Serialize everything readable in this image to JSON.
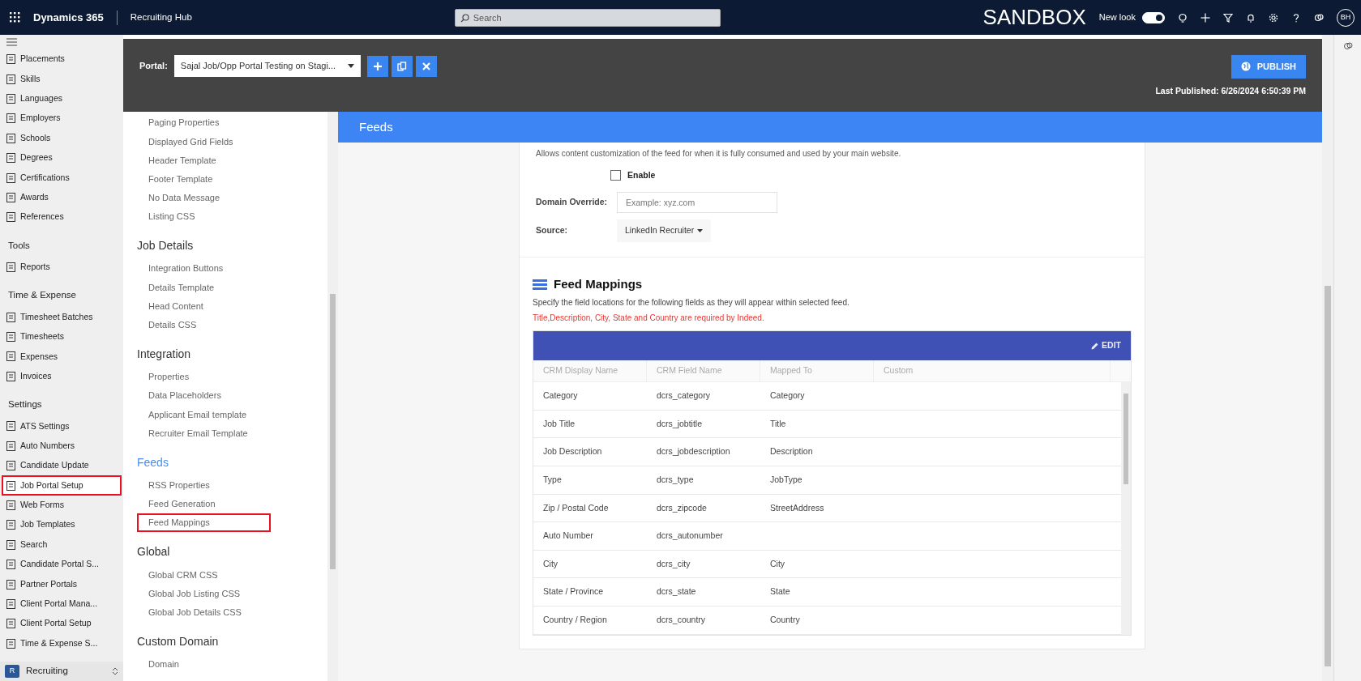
{
  "top_bar": {
    "app_name": "Dynamics 365",
    "area": "Recruiting Hub",
    "search": {
      "placeholder": "Search"
    },
    "environment": "SANDBOX",
    "new_look": {
      "label": "New look",
      "on": true
    },
    "avatar": "BH"
  },
  "sidebar": {
    "items": [
      {
        "kind": "item",
        "label": "Placements",
        "selected": false
      },
      {
        "kind": "item",
        "label": "Skills",
        "selected": false
      },
      {
        "kind": "item",
        "label": "Languages",
        "selected": false
      },
      {
        "kind": "item",
        "label": "Employers",
        "selected": false
      },
      {
        "kind": "item",
        "label": "Schools",
        "selected": false
      },
      {
        "kind": "item",
        "label": "Degrees",
        "selected": false
      },
      {
        "kind": "item",
        "label": "Certifications",
        "selected": false
      },
      {
        "kind": "item",
        "label": "Awards",
        "selected": false
      },
      {
        "kind": "item",
        "label": "References",
        "selected": false
      },
      {
        "kind": "heading",
        "label": "Tools"
      },
      {
        "kind": "item",
        "label": "Reports",
        "selected": false
      },
      {
        "kind": "heading",
        "label": "Time & Expense"
      },
      {
        "kind": "item",
        "label": "Timesheet Batches",
        "selected": false
      },
      {
        "kind": "item",
        "label": "Timesheets",
        "selected": false
      },
      {
        "kind": "item",
        "label": "Expenses",
        "selected": false
      },
      {
        "kind": "item",
        "label": "Invoices",
        "selected": false
      },
      {
        "kind": "heading",
        "label": "Settings"
      },
      {
        "kind": "item",
        "label": "ATS Settings",
        "selected": false
      },
      {
        "kind": "item",
        "label": "Auto Numbers",
        "selected": false
      },
      {
        "kind": "item",
        "label": "Candidate Update",
        "selected": false
      },
      {
        "kind": "item",
        "label": "Job Portal Setup",
        "selected": true
      },
      {
        "kind": "item",
        "label": "Web Forms",
        "selected": false
      },
      {
        "kind": "item",
        "label": "Job Templates",
        "selected": false
      },
      {
        "kind": "item",
        "label": "Search",
        "selected": false
      },
      {
        "kind": "item",
        "label": "Candidate Portal S...",
        "selected": false
      },
      {
        "kind": "item",
        "label": "Partner Portals",
        "selected": false
      },
      {
        "kind": "item",
        "label": "Client Portal Mana...",
        "selected": false
      },
      {
        "kind": "item",
        "label": "Client Portal Setup",
        "selected": false
      },
      {
        "kind": "item",
        "label": "Time & Expense S...",
        "selected": false
      }
    ],
    "area_switcher": {
      "badge": "R",
      "label": "Recruiting"
    }
  },
  "portal_bar": {
    "label": "Portal:",
    "portal": "Sajal Job/Opp Portal Testing on Stagi...",
    "publish": "PUBLISH",
    "last_published": "Last Published: 6/26/2024 6:50:39 PM"
  },
  "settings_nav": {
    "groups": [
      {
        "items": [
          {
            "label": "Paging Properties",
            "selected": false
          },
          {
            "label": "Displayed Grid Fields",
            "selected": false
          },
          {
            "label": "Header Template",
            "selected": false
          },
          {
            "label": "Footer Template",
            "selected": false
          },
          {
            "label": "No Data Message",
            "selected": false
          },
          {
            "label": "Listing CSS",
            "selected": false
          }
        ]
      },
      {
        "heading": "Job Details",
        "selected": false,
        "items": [
          {
            "label": "Integration Buttons",
            "selected": false
          },
          {
            "label": "Details Template",
            "selected": false
          },
          {
            "label": "Head Content",
            "selected": false
          },
          {
            "label": "Details CSS",
            "selected": false
          }
        ]
      },
      {
        "heading": "Integration",
        "selected": false,
        "items": [
          {
            "label": "Properties",
            "selected": false
          },
          {
            "label": "Data Placeholders",
            "selected": false
          },
          {
            "label": "Applicant Email template",
            "selected": false
          },
          {
            "label": "Recruiter Email Template",
            "selected": false
          }
        ]
      },
      {
        "heading": "Feeds",
        "selected": true,
        "items": [
          {
            "label": "RSS Properties",
            "selected": false
          },
          {
            "label": "Feed Generation",
            "selected": false
          },
          {
            "label": "Feed Mappings",
            "selected": true
          }
        ]
      },
      {
        "heading": "Global",
        "selected": false,
        "items": [
          {
            "label": "Global CRM CSS",
            "selected": false
          },
          {
            "label": "Global Job Listing CSS",
            "selected": false
          },
          {
            "label": "Global Job Details CSS",
            "selected": false
          }
        ]
      },
      {
        "heading": "Custom Domain",
        "selected": false,
        "items": [
          {
            "label": "Domain",
            "selected": false
          }
        ]
      }
    ]
  },
  "page_title": "Feeds",
  "feed_options": {
    "description": "Allows content customization of the feed for when it is fully consumed and used by your main website.",
    "enable": {
      "label": "Enable",
      "checked": false
    },
    "domain_override": {
      "label": "Domain Override:",
      "placeholder": "Example: xyz.com"
    },
    "source": {
      "label": "Source:",
      "value": "LinkedIn Recruiter"
    }
  },
  "feed_mappings": {
    "title": "Feed Mappings",
    "description": "Specify the field locations for the following fields as they will appear within selected feed.",
    "requirement": "Title,Description, City, State and Country are required by Indeed.",
    "edit": "EDIT",
    "columns": [
      "CRM Display Name",
      "CRM Field Name",
      "Mapped To",
      "Custom"
    ],
    "rows": [
      {
        "display_name": "Category",
        "field_name": "dcrs_category",
        "mapped_to": "Category"
      },
      {
        "display_name": "Job Title",
        "field_name": "dcrs_jobtitle",
        "mapped_to": "Title"
      },
      {
        "display_name": "Job Description",
        "field_name": "dcrs_jobdescription",
        "mapped_to": "Description"
      },
      {
        "display_name": "Type",
        "field_name": "dcrs_type",
        "mapped_to": "JobType"
      },
      {
        "display_name": "Zip / Postal Code",
        "field_name": "dcrs_zipcode",
        "mapped_to": "StreetAddress"
      },
      {
        "display_name": "Auto Number",
        "field_name": "dcrs_autonumber"
      },
      {
        "display_name": "City",
        "field_name": "dcrs_city",
        "mapped_to": "City"
      },
      {
        "display_name": "State / Province",
        "field_name": "dcrs_state",
        "mapped_to": "State"
      },
      {
        "display_name": "Country / Region",
        "field_name": "dcrs_country",
        "mapped_to": "Country"
      }
    ]
  }
}
